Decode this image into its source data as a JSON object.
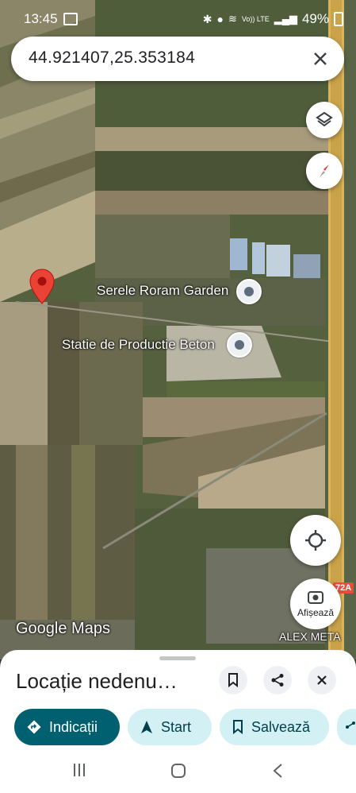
{
  "status": {
    "time": "13:45",
    "battery": "49%",
    "network": "Vo)) LTE"
  },
  "search": {
    "query": "44.921407,25.353184"
  },
  "map": {
    "pois": [
      {
        "label": "Serele Roram Garden"
      },
      {
        "label": "Statie de Productie Beton"
      }
    ],
    "road_badge": "72A",
    "company_label": "ALEX META",
    "attribution": "Google Maps",
    "show_label": "Afișează"
  },
  "sheet": {
    "title": "Locație nedenu…",
    "actions": [
      {
        "label": "Indicații",
        "icon": "directions-icon"
      },
      {
        "label": "Start",
        "icon": "navigation-icon"
      },
      {
        "label": "Salvează",
        "icon": "bookmark-icon"
      }
    ]
  },
  "colors": {
    "primary": "#0b57d0",
    "teal": "#00606f",
    "chip_bg": "#d3f1f5",
    "pin": "#ea4335"
  }
}
